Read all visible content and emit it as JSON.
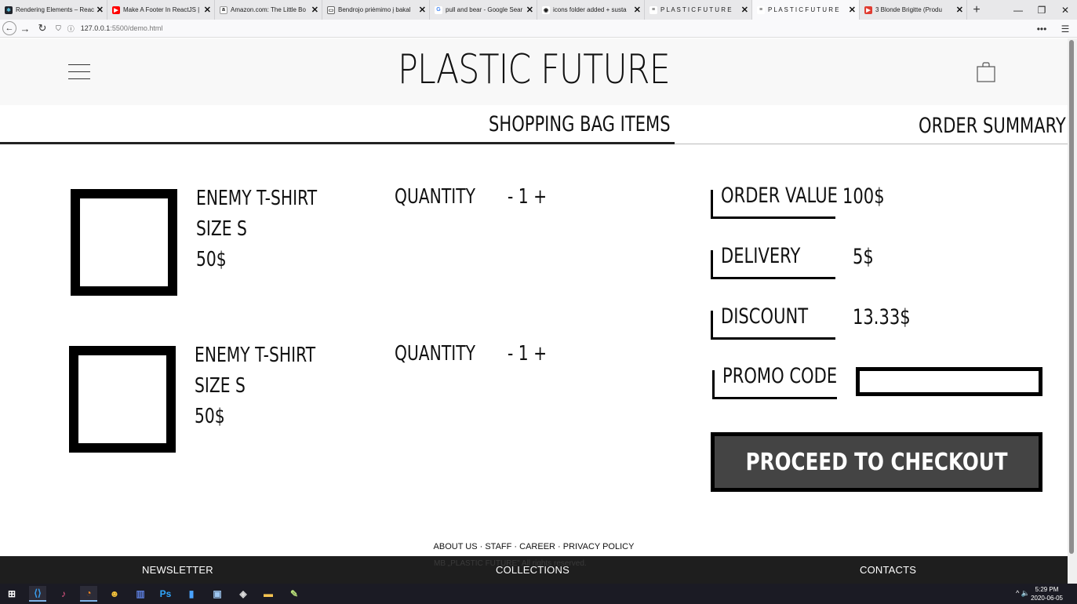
{
  "browser": {
    "tabs": [
      {
        "title": "Rendering Elements – React",
        "favicon_color": "#20232a",
        "favicon_glyph": "⚛"
      },
      {
        "title": "Make A Footer In ReactJS |",
        "favicon_color": "#ff0000",
        "favicon_glyph": "▶"
      },
      {
        "title": "Amazon.com: The Little Bo",
        "favicon_color": "#ffffff",
        "favicon_glyph": "a"
      },
      {
        "title": "Bendrojo priėmimo į bakal",
        "favicon_color": "#ffffff",
        "favicon_glyph": "▭"
      },
      {
        "title": "pull and bear - Google Sear",
        "favicon_color": "#ffffff",
        "favicon_glyph": "G"
      },
      {
        "title": "icons folder added + susta",
        "favicon_color": "#ffffff",
        "favicon_glyph": "◉"
      },
      {
        "title": "P L A S T I C F U T U R E",
        "favicon_color": "#ffffff",
        "favicon_glyph": "≡"
      },
      {
        "title": "P L A S T I C F U T U R E",
        "favicon_color": "#ffffff",
        "favicon_glyph": "≡"
      },
      {
        "title": "3 Blonde Brigitte (Produ",
        "favicon_color": "#e03c31",
        "favicon_glyph": "▶"
      }
    ],
    "active_tab_index": 7,
    "close_glyph": "✕",
    "new_tab_glyph": "+",
    "window_controls": {
      "minimize": "—",
      "restore": "❐",
      "close": "✕"
    },
    "nav": {
      "back": "←",
      "forward": "→",
      "reload": "↻"
    },
    "url": {
      "host": "127.0.0.1",
      "rest": ":5500/demo.html"
    },
    "menu_dots": "•••",
    "hamburger_glyph": "☰"
  },
  "site": {
    "logo": "PLASTIC FUTURE",
    "bag_section_title": "SHOPPING BAG ITEMS",
    "summary_section_title": "ORDER SUMMARY",
    "items": [
      {
        "name": "ENEMY T-SHIRT",
        "size": "SIZE S",
        "price": "50$",
        "quantity_label": "QUANTITY",
        "quantity_control": "- 1 +"
      },
      {
        "name": "ENEMY T-SHIRT",
        "size": "SIZE S",
        "price": "50$",
        "quantity_label": "QUANTITY",
        "quantity_control": "- 1 +"
      }
    ],
    "summary": {
      "order_value_label": "ORDER VALUE",
      "order_value": "100$",
      "delivery_label": "DELIVERY",
      "delivery": "5$",
      "discount_label": "DISCOUNT",
      "discount": "13.33$",
      "promo_label": "PROMO CODE",
      "promo_value": ""
    },
    "checkout_label": "PROCEED TO CHECKOUT",
    "footer": {
      "links": [
        "ABOUT US",
        "STAFF",
        "CAREER",
        "PRIVACY POLICY"
      ],
      "link_separator": " · ",
      "columns": [
        "NEWSLETTER",
        "COLLECTIONS",
        "CONTACTS"
      ],
      "copyright": "MB „PLASTIC FUTURE\" All rights reserved."
    }
  },
  "taskbar": {
    "time": "5:29 PM",
    "date": "2020-06-05",
    "tray": "^  🔈"
  }
}
